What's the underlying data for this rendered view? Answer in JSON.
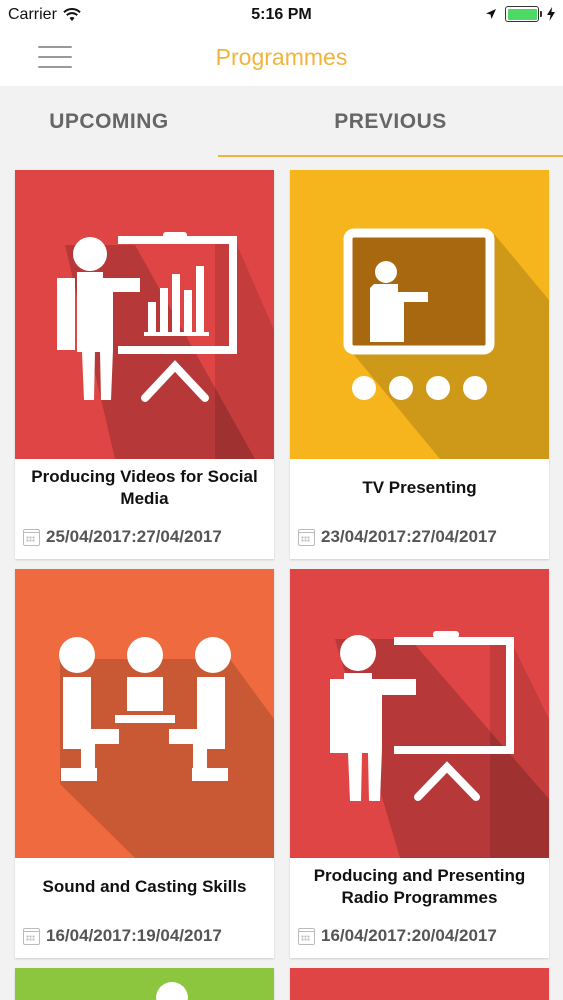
{
  "status_bar": {
    "carrier": "Carrier",
    "time": "5:16 PM"
  },
  "nav": {
    "title": "Programmes",
    "menu_icon": "hamburger-menu-icon"
  },
  "tabs": [
    {
      "label": "UPCOMING",
      "active": false
    },
    {
      "label": "PREVIOUS",
      "active": true
    }
  ],
  "colors": {
    "accent": "#f2b33d",
    "red": "#e04545",
    "yellow": "#f6b51d",
    "orange": "#f06a3f"
  },
  "programmes": [
    {
      "title": "Producing Videos for Social Media",
      "dates": "25/04/2017:27/04/2017",
      "icon": "presenter-chart-icon",
      "color": "#e04545"
    },
    {
      "title": "TV Presenting",
      "dates": "23/04/2017:27/04/2017",
      "icon": "tv-presenter-icon",
      "color": "#f6b51d"
    },
    {
      "title": "Sound and Casting Skills",
      "dates": "16/04/2017:19/04/2017",
      "icon": "casting-panel-icon",
      "color": "#f06a3f"
    },
    {
      "title": "Producing and Presenting Radio Programmes",
      "dates": "16/04/2017:20/04/2017",
      "icon": "presenter-board-icon",
      "color": "#e04545"
    }
  ]
}
